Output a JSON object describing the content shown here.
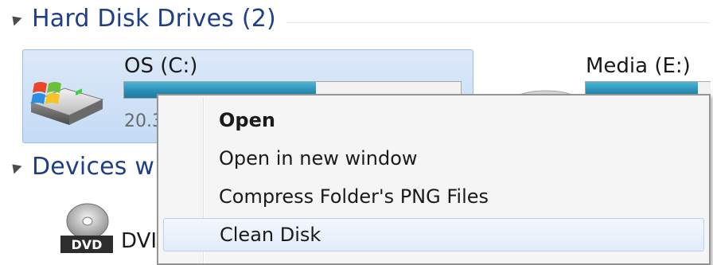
{
  "groups": {
    "hard_disk": {
      "label": "Hard Disk Drives (2)"
    },
    "devices": {
      "label": "Devices wi"
    }
  },
  "drives": [
    {
      "name": "OS (C:)",
      "free_text": "20.3",
      "fill_fraction": 0.57
    },
    {
      "name": "Media (E:)",
      "fill_fraction": 0.9
    }
  ],
  "dvd": {
    "label": "DVI",
    "icon_text": "DVD"
  },
  "context_menu": {
    "items": [
      {
        "label": "Open",
        "bold": true
      },
      {
        "label": "Open in new window"
      },
      {
        "label": "Compress Folder's PNG Files"
      },
      {
        "label": "Clean Disk",
        "highlighted": true
      }
    ]
  },
  "colors": {
    "group_header": "#1e3e87",
    "selection_bg": "#c4dbf5",
    "bar_fill": "#2a8fb6"
  }
}
